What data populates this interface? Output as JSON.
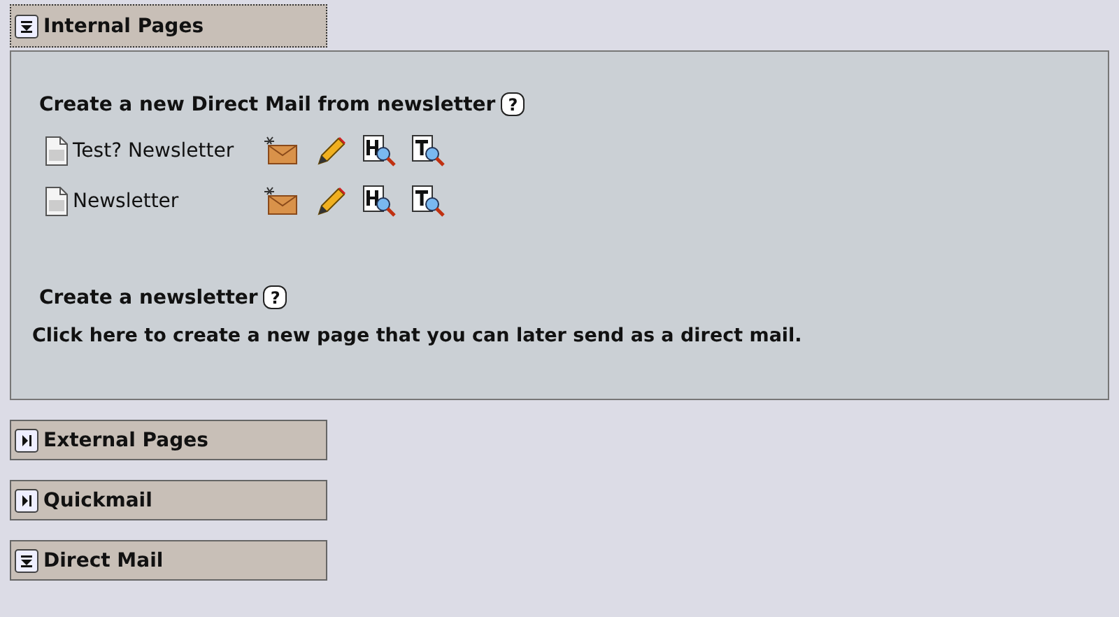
{
  "sections": [
    {
      "title": "Internal Pages",
      "expanded": true,
      "focused": true,
      "content": {
        "newsletter_heading": "Create a new Direct Mail from newsletter",
        "help_glyph": "?",
        "newsletters": [
          {
            "name": "Test? Newsletter"
          },
          {
            "name": "Newsletter"
          }
        ],
        "create_heading": "Create a newsletter",
        "create_help_glyph": "?",
        "create_link": "Click here to create a new page that you can later send as a direct mail."
      }
    },
    {
      "title": "External Pages",
      "expanded": false,
      "focused": false
    },
    {
      "title": "Quickmail",
      "expanded": false,
      "focused": false
    },
    {
      "title": "Direct Mail",
      "expanded": true,
      "focused": false
    }
  ]
}
